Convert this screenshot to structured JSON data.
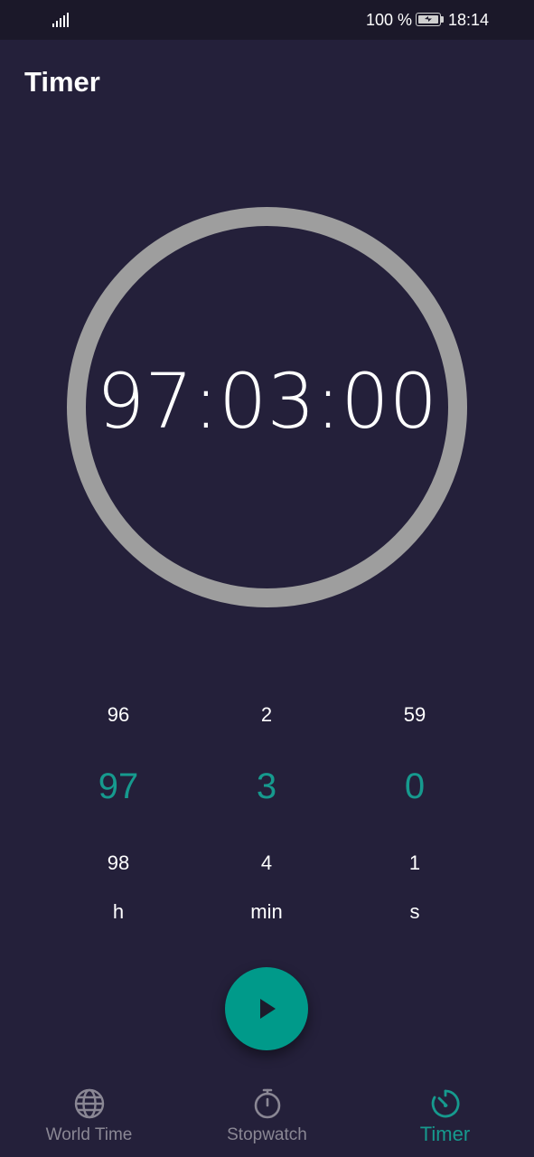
{
  "status_bar": {
    "battery_percent": "100 %",
    "time": "18:14",
    "icons": [
      "signal-icon",
      "battery-charging-icon"
    ]
  },
  "header": {
    "title": "Timer"
  },
  "timer_display": {
    "time": "97:03:00",
    "ring_color": "#9e9e9e"
  },
  "picker": {
    "hours": {
      "prev": "96",
      "selected": "97",
      "next": "98",
      "unit": "h"
    },
    "minutes": {
      "prev": "2",
      "selected": "3",
      "next": "4",
      "unit": "min"
    },
    "seconds": {
      "prev": "59",
      "selected": "0",
      "next": "1",
      "unit": "s"
    },
    "accent_color": "#169a8e"
  },
  "play_button": {
    "icon": "play-icon",
    "color": "#009a8a"
  },
  "bottom_nav": {
    "items": [
      {
        "label": "World Time",
        "icon": "globe-icon",
        "active": false
      },
      {
        "label": "Stopwatch",
        "icon": "stopwatch-icon",
        "active": false
      },
      {
        "label": "Timer",
        "icon": "timer-icon",
        "active": true
      }
    ]
  },
  "colors": {
    "background": "#24203a",
    "status_bar": "#1b1829",
    "inactive": "#8a8794",
    "accent": "#169a8e"
  }
}
